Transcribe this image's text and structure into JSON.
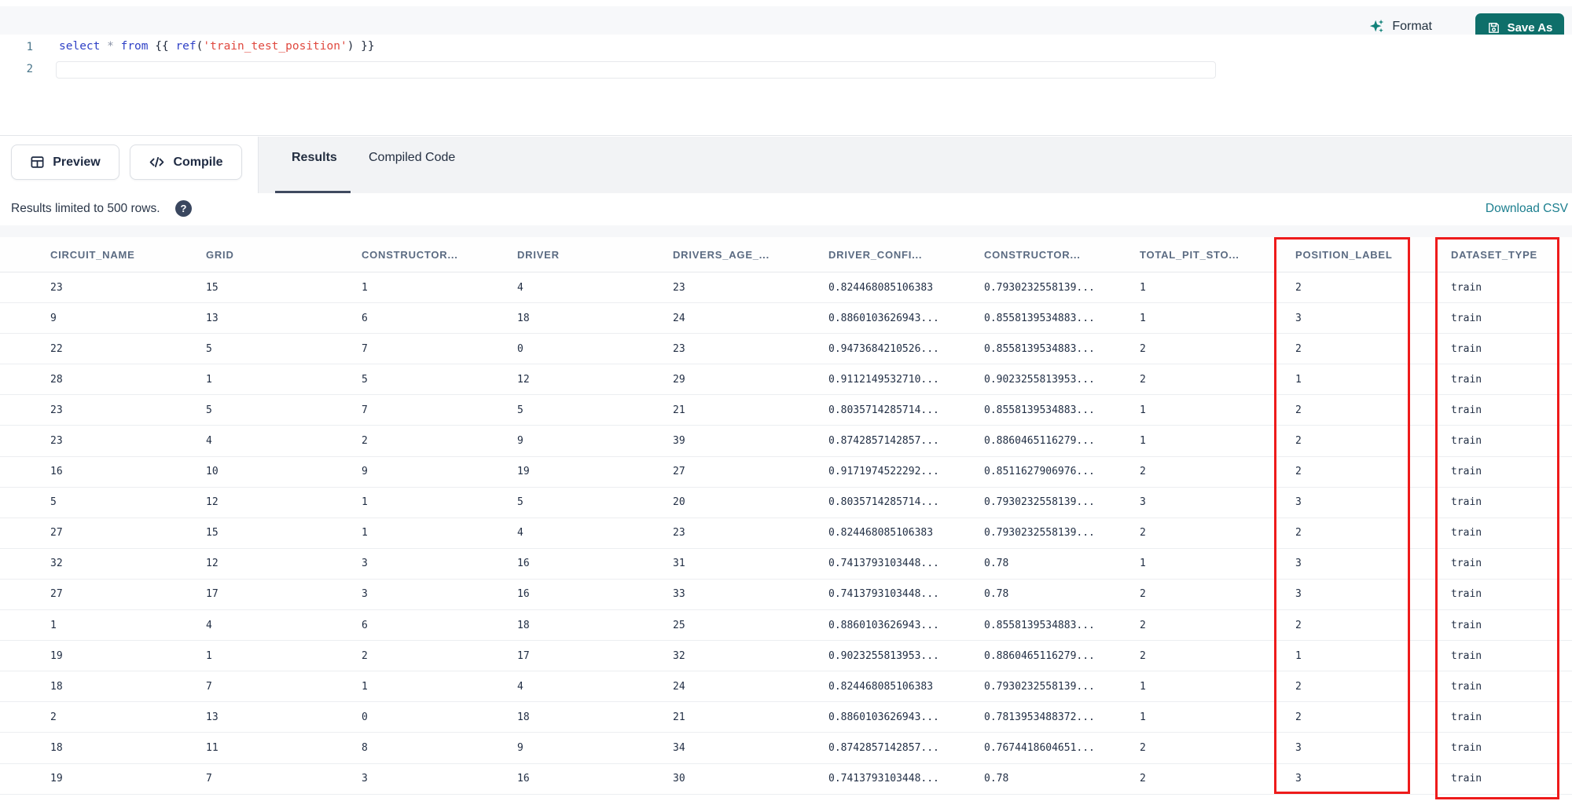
{
  "toolbar": {
    "format_label": "Format",
    "save_as_label": "Save As"
  },
  "editor": {
    "line_numbers": [
      "1",
      "2"
    ],
    "code_tokens": [
      {
        "t": "select",
        "c": "kw"
      },
      {
        "t": " ",
        "c": "pn"
      },
      {
        "t": "*",
        "c": "op"
      },
      {
        "t": " ",
        "c": "pn"
      },
      {
        "t": "from",
        "c": "kw"
      },
      {
        "t": " {{ ",
        "c": "pn"
      },
      {
        "t": "ref",
        "c": "fn"
      },
      {
        "t": "(",
        "c": "pn"
      },
      {
        "t": "'train_test_position'",
        "c": "st"
      },
      {
        "t": ")",
        "c": "pn"
      },
      {
        "t": " }}",
        "c": "pn"
      }
    ]
  },
  "actions": {
    "preview_label": "Preview",
    "compile_label": "Compile"
  },
  "tabs": [
    {
      "label": "Results",
      "active": true
    },
    {
      "label": "Compiled Code",
      "active": false
    }
  ],
  "results_bar": {
    "info_text": "Results limited to 500 rows.",
    "help_icon": "question-mark",
    "download_label": "Download CSV"
  },
  "table": {
    "columns": [
      "CIRCUIT_NAME",
      "GRID",
      "CONSTRUCTOR...",
      "DRIVER",
      "DRIVERS_AGE_...",
      "DRIVER_CONFI...",
      "CONSTRUCTOR...",
      "TOTAL_PIT_STO...",
      "POSITION_LABEL",
      "DATASET_TYPE"
    ],
    "highlighted_columns": [
      "POSITION_LABEL",
      "DATASET_TYPE"
    ],
    "rows": [
      [
        "23",
        "15",
        "1",
        "4",
        "23",
        "0.824468085106383",
        "0.7930232558139...",
        "1",
        "2",
        "train"
      ],
      [
        "9",
        "13",
        "6",
        "18",
        "24",
        "0.8860103626943...",
        "0.8558139534883...",
        "1",
        "3",
        "train"
      ],
      [
        "22",
        "5",
        "7",
        "0",
        "23",
        "0.9473684210526...",
        "0.8558139534883...",
        "2",
        "2",
        "train"
      ],
      [
        "28",
        "1",
        "5",
        "12",
        "29",
        "0.9112149532710...",
        "0.9023255813953...",
        "2",
        "1",
        "train"
      ],
      [
        "23",
        "5",
        "7",
        "5",
        "21",
        "0.8035714285714...",
        "0.8558139534883...",
        "1",
        "2",
        "train"
      ],
      [
        "23",
        "4",
        "2",
        "9",
        "39",
        "0.8742857142857...",
        "0.8860465116279...",
        "1",
        "2",
        "train"
      ],
      [
        "16",
        "10",
        "9",
        "19",
        "27",
        "0.9171974522292...",
        "0.8511627906976...",
        "2",
        "2",
        "train"
      ],
      [
        "5",
        "12",
        "1",
        "5",
        "20",
        "0.8035714285714...",
        "0.7930232558139...",
        "3",
        "3",
        "train"
      ],
      [
        "27",
        "15",
        "1",
        "4",
        "23",
        "0.824468085106383",
        "0.7930232558139...",
        "2",
        "2",
        "train"
      ],
      [
        "32",
        "12",
        "3",
        "16",
        "31",
        "0.7413793103448...",
        "0.78",
        "1",
        "3",
        "train"
      ],
      [
        "27",
        "17",
        "3",
        "16",
        "33",
        "0.7413793103448...",
        "0.78",
        "2",
        "3",
        "train"
      ],
      [
        "1",
        "4",
        "6",
        "18",
        "25",
        "0.8860103626943...",
        "0.8558139534883...",
        "2",
        "2",
        "train"
      ],
      [
        "19",
        "1",
        "2",
        "17",
        "32",
        "0.9023255813953...",
        "0.8860465116279...",
        "2",
        "1",
        "train"
      ],
      [
        "18",
        "7",
        "1",
        "4",
        "24",
        "0.824468085106383",
        "0.7930232558139...",
        "1",
        "2",
        "train"
      ],
      [
        "2",
        "13",
        "0",
        "18",
        "21",
        "0.8860103626943...",
        "0.7813953488372...",
        "1",
        "2",
        "train"
      ],
      [
        "18",
        "11",
        "8",
        "9",
        "34",
        "0.8742857142857...",
        "0.7674418604651...",
        "2",
        "3",
        "train"
      ],
      [
        "19",
        "7",
        "3",
        "16",
        "30",
        "0.7413793103448...",
        "0.78",
        "2",
        "3",
        "train"
      ]
    ]
  },
  "colors": {
    "save_button_bg": "#0e6f6a",
    "download_link": "#1b7e8e",
    "sparkle_icon": "#12827a",
    "highlight_box": "#ee1b1b",
    "keyword_blue": "#2f41c6",
    "string_red": "#e0493f"
  }
}
